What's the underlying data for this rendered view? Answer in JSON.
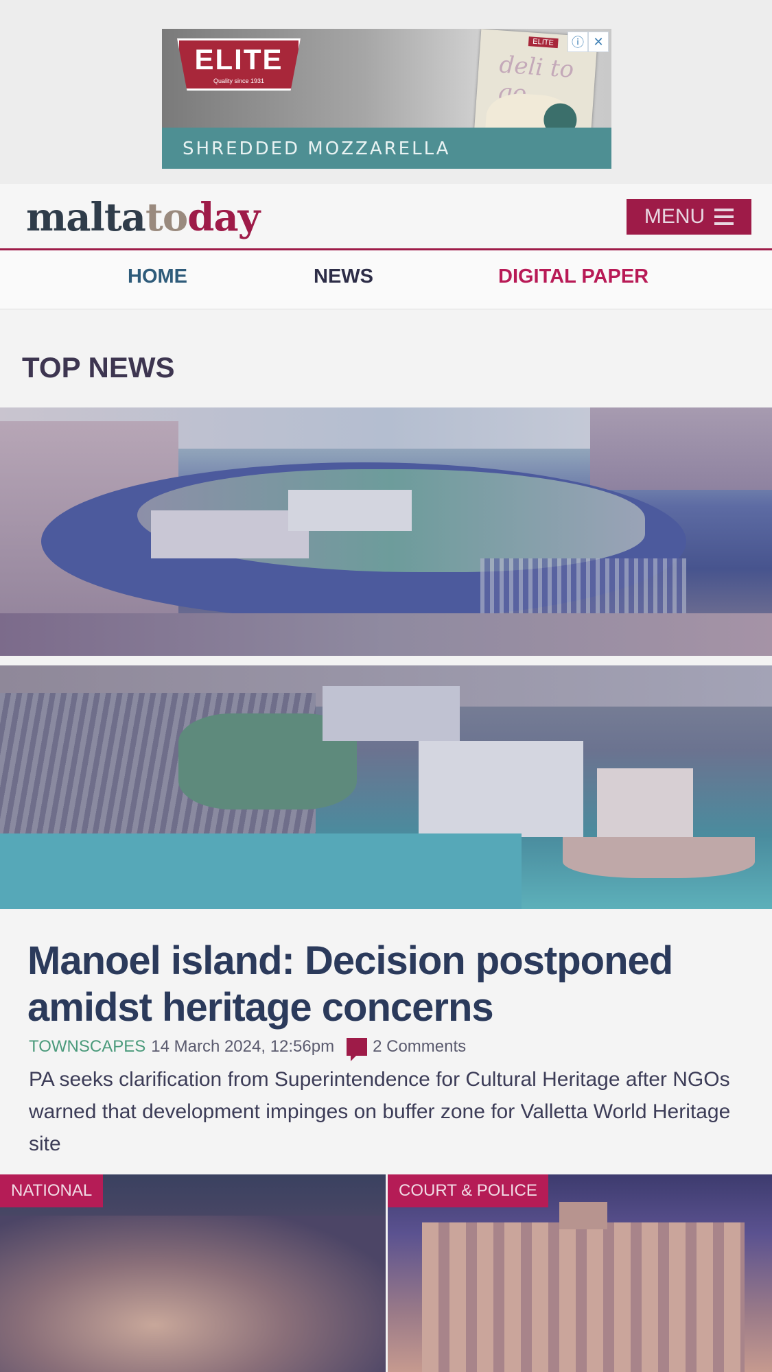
{
  "ad": {
    "brand": "ELITE",
    "brand_tagline": "Quality since 1931",
    "strip_text": "SHREDDED MOZZARELLA",
    "pack_brand": "ELITE",
    "pack_title": "deli to go",
    "info_icon": "info-icon",
    "close_icon": "close-icon",
    "colors": {
      "brand": "#a8273a",
      "strip": "#4e8f93"
    }
  },
  "header": {
    "logo_part1": "malta",
    "logo_part2": "to",
    "logo_part3": "day",
    "menu_label": "MENU",
    "menu_icon": "hamburger-icon",
    "accent": "#9e1b48"
  },
  "nav": {
    "items": [
      {
        "label": "HOME"
      },
      {
        "label": "NEWS"
      },
      {
        "label": "DIGITAL PAPER"
      }
    ]
  },
  "section": {
    "title": "TOP NEWS"
  },
  "top_story": {
    "headline": "Manoel island: Decision postponed amidst heritage concerns",
    "category": "TOWNSCAPES",
    "date": "14 March 2024, 12:56pm",
    "comments": "2 Comments",
    "comment_icon": "comment-icon",
    "summary": "PA seeks clarification from Superintendence for Cultural Heritage after NGOs warned that development impinges on buffer zone for Valletta World Heritage site"
  },
  "cards": [
    {
      "tag": "NATIONAL"
    },
    {
      "tag": "COURT & POLICE"
    }
  ]
}
